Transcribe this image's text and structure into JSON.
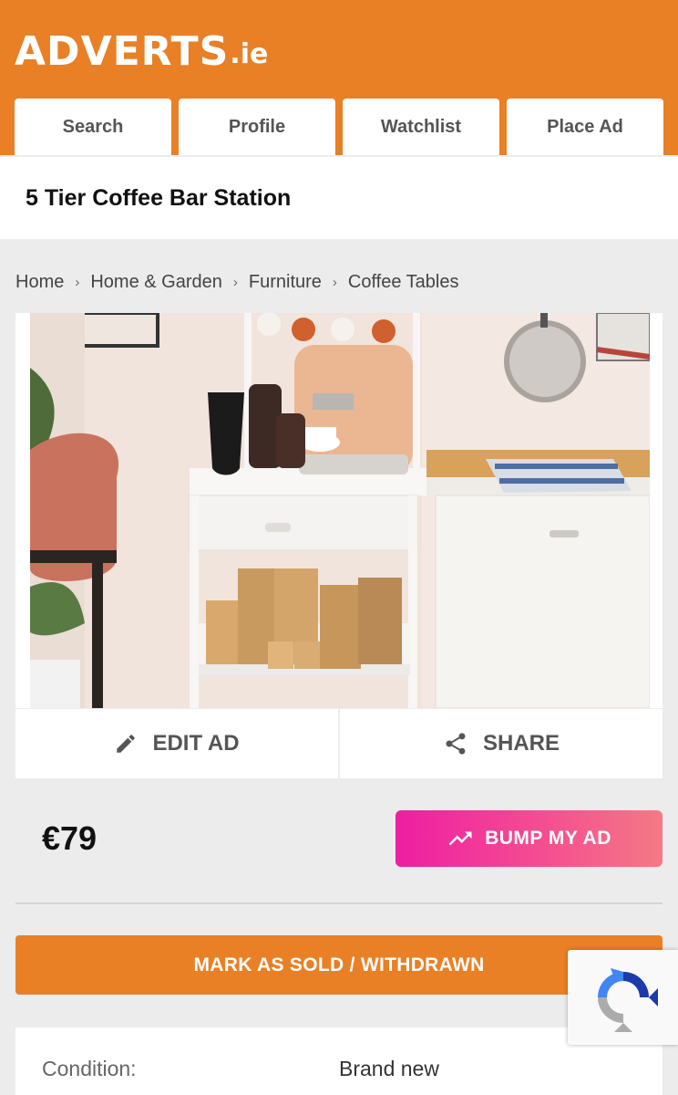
{
  "brand": {
    "name": "ADVERTS",
    "tld": ".ie"
  },
  "nav": {
    "tabs": [
      "Search",
      "Profile",
      "Watchlist",
      "Place Ad"
    ]
  },
  "ad": {
    "title": "5 Tier Coffee Bar Station",
    "price": "€79",
    "condition_label": "Condition:",
    "condition_value": "Brand new"
  },
  "breadcrumb": [
    "Home",
    "Home & Garden",
    "Furniture",
    "Coffee Tables"
  ],
  "actions": {
    "edit": "EDIT AD",
    "share": "SHARE",
    "bump": "BUMP MY AD",
    "sold": "MARK AS SOLD / WITHDRAWN"
  },
  "icons": {
    "edit": "pencil-icon",
    "share": "share-icon",
    "bump": "trending-up-icon",
    "captcha": "recaptcha-icon"
  },
  "colors": {
    "brand_orange": "#e98026",
    "bump_pink": "#ee1ea3",
    "page_bg": "#ececec"
  }
}
